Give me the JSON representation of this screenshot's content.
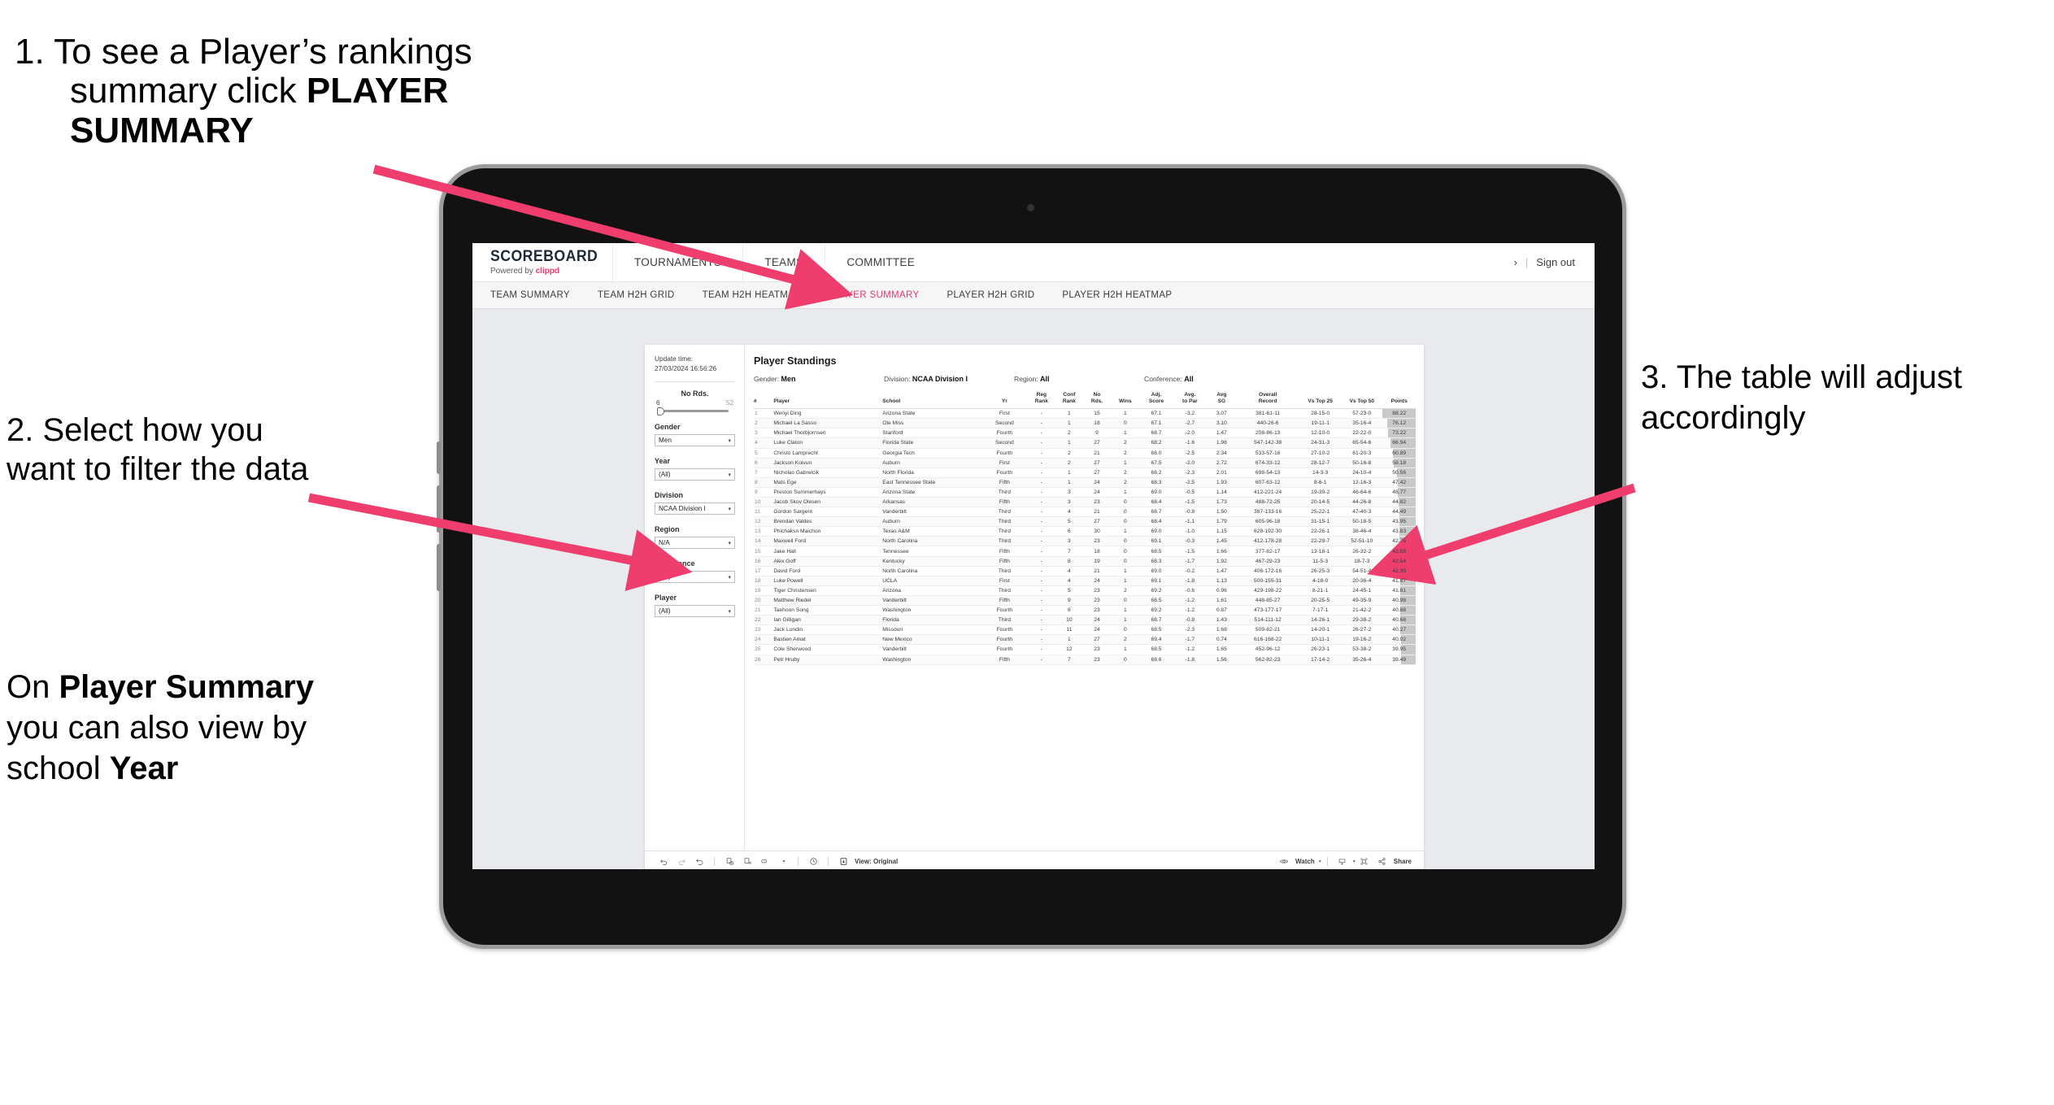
{
  "annotations": {
    "step1": {
      "number": "1.",
      "line1": "To see a Player’s rankings",
      "line2_plain": "summary click ",
      "line2_bold": "PLAYER",
      "line3_bold": "SUMMARY"
    },
    "step2": {
      "text": "2. Select how you want to filter the data"
    },
    "step2b": {
      "pre": "On ",
      "bold1": "Player Summary",
      "mid": " you can also view by school ",
      "bold2": "Year"
    },
    "step3": {
      "text": "3. The table will adjust accordingly"
    },
    "arrow_color": "#ef3d6e"
  },
  "app": {
    "logo": {
      "main": "SCOREBOARD",
      "sub_prefix": "Powered by ",
      "sub_brand": "clippd"
    },
    "topnav": [
      "TOURNAMENTS",
      "TEAMS",
      "COMMITTEE"
    ],
    "topright": {
      "chevron": "›",
      "separator": "|",
      "signout": "Sign out"
    },
    "subnav": {
      "tabs": [
        "TEAM SUMMARY",
        "TEAM H2H GRID",
        "TEAM H2H HEATMAP",
        "PLAYER SUMMARY",
        "PLAYER H2H GRID",
        "PLAYER H2H HEATMAP"
      ],
      "active": "PLAYER SUMMARY",
      "active_color": "#e8386e"
    }
  },
  "filters": {
    "update_label": "Update time:",
    "update_value": "27/03/2024 16:56:26",
    "slider": {
      "label": "No Rds.",
      "min": "6",
      "max": "52"
    },
    "groups": [
      {
        "label": "Gender",
        "value": "Men"
      },
      {
        "label": "Year",
        "value": "(All)"
      },
      {
        "label": "Division",
        "value": "NCAA Division I"
      },
      {
        "label": "Region",
        "value": "N/A"
      },
      {
        "label": "Conference",
        "value": "(All)"
      },
      {
        "label": "Player",
        "value": "(All)"
      }
    ]
  },
  "report": {
    "title": "Player Standings",
    "crumbs": [
      {
        "label": "Gender:",
        "value": "Men"
      },
      {
        "label": "Division:",
        "value": "NCAA Division I"
      },
      {
        "label": "Region:",
        "value": "All"
      },
      {
        "label": "Conference:",
        "value": "All"
      }
    ],
    "columns": [
      {
        "key": "rank",
        "l1": "#",
        "l2": ""
      },
      {
        "key": "player",
        "l1": "Player",
        "l2": ""
      },
      {
        "key": "school",
        "l1": "School",
        "l2": ""
      },
      {
        "key": "yr",
        "l1": "Yr",
        "l2": ""
      },
      {
        "key": "reg_rank",
        "l1": "Reg",
        "l2": "Rank"
      },
      {
        "key": "conf_rank",
        "l1": "Conf",
        "l2": "Rank"
      },
      {
        "key": "no_rds",
        "l1": "No",
        "l2": "Rds."
      },
      {
        "key": "wins",
        "l1": "Wins",
        "l2": ""
      },
      {
        "key": "adj_score",
        "l1": "Adj.",
        "l2": "Score"
      },
      {
        "key": "avg_to_par",
        "l1": "Avg.",
        "l2": "to Par"
      },
      {
        "key": "avg_sg",
        "l1": "Avg",
        "l2": "SG"
      },
      {
        "key": "overall_record",
        "l1": "Overall",
        "l2": "Record"
      },
      {
        "key": "vs_top25",
        "l1": "Vs Top 25",
        "l2": ""
      },
      {
        "key": "vs_top50",
        "l1": "Vs Top 50",
        "l2": ""
      },
      {
        "key": "points",
        "l1": "Points",
        "l2": ""
      }
    ],
    "rows": [
      [
        "1",
        "Wenyi Ding",
        "Arizona State",
        "First",
        "-",
        "1",
        "15",
        "1",
        "67.1",
        "-3.2",
        "3.07",
        "381-61-11",
        "28-15-0",
        "57-23-0",
        "88.22"
      ],
      [
        "2",
        "Michael La Sasso",
        "Ole Miss",
        "Second",
        "-",
        "1",
        "18",
        "0",
        "67.1",
        "-2.7",
        "3.10",
        "440-26-6",
        "19-11-1",
        "35-16-4",
        "76.12"
      ],
      [
        "3",
        "Michael Thorbjornsen",
        "Stanford",
        "Fourth",
        "-",
        "2",
        "9",
        "1",
        "68.7",
        "-2.0",
        "1.47",
        "208-86-13",
        "12-10-0",
        "22-22-0",
        "73.22"
      ],
      [
        "4",
        "Luke Claton",
        "Florida State",
        "Second",
        "-",
        "1",
        "27",
        "2",
        "68.2",
        "-1.6",
        "1.98",
        "547-142-38",
        "24-31-3",
        "65-54-6",
        "66.94"
      ],
      [
        "5",
        "Christo Lamprecht",
        "Georgia Tech",
        "Fourth",
        "-",
        "2",
        "21",
        "2",
        "68.0",
        "-2.5",
        "2.34",
        "533-57-16",
        "27-10-2",
        "61-20-3",
        "60.89"
      ],
      [
        "6",
        "Jackson Koivun",
        "Auburn",
        "First",
        "-",
        "2",
        "27",
        "1",
        "67.5",
        "-2.0",
        "2.72",
        "674-33-12",
        "28-12-7",
        "50-16-8",
        "58.18"
      ],
      [
        "7",
        "Nicholas Gabrelcik",
        "North Florida",
        "Fourth",
        "-",
        "1",
        "27",
        "2",
        "68.2",
        "-2.3",
        "2.01",
        "698-54-13",
        "14-3-3",
        "24-10-4",
        "50.56"
      ],
      [
        "8",
        "Mats Ege",
        "East Tennessee State",
        "Fifth",
        "-",
        "1",
        "24",
        "2",
        "68.3",
        "-2.5",
        "1.93",
        "607-63-12",
        "8-6-1",
        "12-16-3",
        "47.42"
      ],
      [
        "9",
        "Preston Summerhays",
        "Arizona State",
        "Third",
        "-",
        "3",
        "24",
        "1",
        "69.0",
        "-0.5",
        "1.14",
        "412-221-24",
        "19-39-2",
        "46-64-6",
        "46.77"
      ],
      [
        "10",
        "Jacob Skov Olesen",
        "Arkansas",
        "Fifth",
        "-",
        "3",
        "23",
        "0",
        "68.4",
        "-1.5",
        "1.73",
        "488-72-25",
        "20-14-5",
        "44-26-8",
        "44.82"
      ],
      [
        "11",
        "Gordon Sargent",
        "Vanderbilt",
        "Third",
        "-",
        "4",
        "21",
        "0",
        "68.7",
        "-0.8",
        "1.50",
        "387-133-16",
        "25-22-1",
        "47-40-3",
        "44.49"
      ],
      [
        "12",
        "Brendan Valdes",
        "Auburn",
        "Third",
        "-",
        "5",
        "27",
        "0",
        "68.4",
        "-1.1",
        "1.79",
        "605-96-18",
        "31-15-1",
        "50-18-5",
        "43.95"
      ],
      [
        "13",
        "Phichaksn Maichon",
        "Texas A&M",
        "Third",
        "-",
        "6",
        "30",
        "1",
        "69.0",
        "-1.0",
        "1.15",
        "628-192-30",
        "22-26-1",
        "38-46-4",
        "43.83"
      ],
      [
        "14",
        "Maxwell Ford",
        "North Carolina",
        "Third",
        "-",
        "3",
        "23",
        "0",
        "69.1",
        "-0.3",
        "1.45",
        "412-178-28",
        "22-29-7",
        "52-51-10",
        "42.75"
      ],
      [
        "15",
        "Jake Hall",
        "Tennessee",
        "Fifth",
        "-",
        "7",
        "18",
        "0",
        "68.5",
        "-1.5",
        "1.66",
        "377-82-17",
        "13-18-1",
        "26-32-2",
        "42.55"
      ],
      [
        "16",
        "Alex Goff",
        "Kentucky",
        "Fifth",
        "-",
        "8",
        "19",
        "0",
        "68.3",
        "-1.7",
        "1.92",
        "467-29-23",
        "11-5-3",
        "18-7-3",
        "42.54"
      ],
      [
        "17",
        "David Ford",
        "North Carolina",
        "Third",
        "-",
        "4",
        "21",
        "1",
        "69.0",
        "-0.2",
        "1.47",
        "406-172-16",
        "26-25-3",
        "54-51-4",
        "42.35"
      ],
      [
        "18",
        "Luke Powell",
        "UCLA",
        "First",
        "-",
        "4",
        "24",
        "1",
        "69.1",
        "-1.8",
        "1.13",
        "500-155-31",
        "4-18-0",
        "20-36-4",
        "41.87"
      ],
      [
        "19",
        "Tiger Christensen",
        "Arizona",
        "Third",
        "-",
        "5",
        "23",
        "2",
        "69.2",
        "-0.6",
        "0.96",
        "429-198-22",
        "8-21-1",
        "24-45-1",
        "41.81"
      ],
      [
        "20",
        "Matthew Riedel",
        "Vanderbilt",
        "Fifth",
        "-",
        "9",
        "23",
        "0",
        "68.5",
        "-1.2",
        "1.61",
        "448-85-27",
        "20-25-5",
        "49-35-9",
        "40.98"
      ],
      [
        "21",
        "Taehoon Song",
        "Washington",
        "Fourth",
        "-",
        "6",
        "23",
        "1",
        "69.2",
        "-1.2",
        "0.87",
        "473-177-17",
        "7-17-1",
        "21-42-2",
        "40.88"
      ],
      [
        "22",
        "Ian Gilligan",
        "Florida",
        "Third",
        "-",
        "10",
        "24",
        "1",
        "68.7",
        "-0.8",
        "1.43",
        "514-111-12",
        "14-26-1",
        "29-38-2",
        "40.68"
      ],
      [
        "23",
        "Jack Lundin",
        "Missouri",
        "Fourth",
        "-",
        "11",
        "24",
        "0",
        "68.5",
        "-2.3",
        "1.68",
        "509-82-21",
        "14-20-1",
        "26-27-2",
        "40.27"
      ],
      [
        "24",
        "Bastien Amat",
        "New Mexico",
        "Fourth",
        "-",
        "1",
        "27",
        "2",
        "69.4",
        "-1.7",
        "0.74",
        "616-168-22",
        "10-11-1",
        "19-16-2",
        "40.02"
      ],
      [
        "25",
        "Cole Sherwood",
        "Vanderbilt",
        "Fourth",
        "-",
        "12",
        "23",
        "1",
        "68.5",
        "-1.2",
        "1.65",
        "452-96-12",
        "26-23-1",
        "53-38-2",
        "39.95"
      ],
      [
        "26",
        "Petr Hruby",
        "Washington",
        "Fifth",
        "-",
        "7",
        "23",
        "0",
        "68.6",
        "-1.8",
        "1.56",
        "562-82-23",
        "17-14-2",
        "35-26-4",
        "39.49"
      ]
    ]
  },
  "toolbar": {
    "left_icons": [
      "undo-icon",
      "redo-icon",
      "revert-icon",
      "refresh-icon",
      "pause-icon",
      "custom-view-icon"
    ],
    "view_label": "View: Original",
    "watch_label": "Watch",
    "share_label": "Share"
  }
}
